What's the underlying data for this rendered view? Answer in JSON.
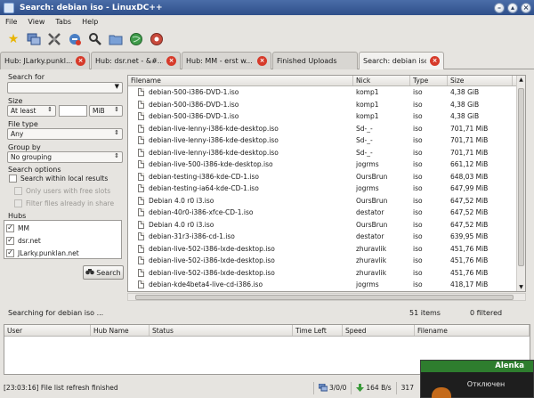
{
  "window": {
    "title": "Search: debian iso - LinuxDC++"
  },
  "menu": [
    "File",
    "View",
    "Tabs",
    "Help"
  ],
  "toolbar_icons": [
    "favorite-star-icon",
    "hubs-icon",
    "settings-icon",
    "connect-icon",
    "search-icon",
    "folder-icon",
    "globe-icon",
    "network-icon"
  ],
  "tabs": [
    {
      "label": "Hub: JLarky.punkl..."
    },
    {
      "label": "Hub: dsr.net - &#..."
    },
    {
      "label": "Hub: MM -  erst w..."
    },
    {
      "label": "Finished Uploads"
    },
    {
      "label": "Search: debian iso"
    }
  ],
  "search_panel": {
    "search_for_label": "Search for",
    "search_for_value": "",
    "size_label": "Size",
    "size_mode": "At least",
    "size_value": "",
    "size_unit": "MiB",
    "file_type_label": "File type",
    "file_type_value": "Any",
    "group_by_label": "Group by",
    "group_by_value": "No grouping",
    "options_label": "Search options",
    "opt_local": "Search within local results",
    "opt_free_slots": "Only users with free slots",
    "opt_filter_share": "Filter files already in share",
    "hubs_label": "Hubs",
    "hubs": [
      "MM",
      "dsr.net",
      "JLarky.punklan.net"
    ],
    "search_button": "Search"
  },
  "results": {
    "columns": [
      "Filename",
      "Nick",
      "Type",
      "Size"
    ],
    "rows": [
      [
        "debian-500-i386-DVD-1.iso",
        "komp1",
        "iso",
        "4,38 GiB"
      ],
      [
        "debian-500-i386-DVD-1.iso",
        "komp1",
        "iso",
        "4,38 GiB"
      ],
      [
        "debian-500-i386-DVD-1.iso",
        "komp1",
        "iso",
        "4,38 GiB"
      ],
      [
        "debian-live-lenny-i386-kde-desktop.iso",
        "Sd-_-",
        "iso",
        "701,71 MiB"
      ],
      [
        "debian-live-lenny-i386-kde-desktop.iso",
        "Sd-_-",
        "iso",
        "701,71 MiB"
      ],
      [
        "debian-live-lenny-i386-kde-desktop.iso",
        "Sd-_-",
        "iso",
        "701,71 MiB"
      ],
      [
        "debian-live-500-i386-kde-desktop.iso",
        "jogrms",
        "iso",
        "661,12 MiB"
      ],
      [
        "debian-testing-i386-kde-CD-1.iso",
        "OursBrun",
        "iso",
        "648,03 MiB"
      ],
      [
        "debian-testing-ia64-kde-CD-1.iso",
        "jogrms",
        "iso",
        "647,99 MiB"
      ],
      [
        "Debian 4.0 r0 i3.iso",
        "OursBrun",
        "iso",
        "647,52 MiB"
      ],
      [
        "debian-40r0-i386-xfce-CD-1.iso",
        "destator",
        "iso",
        "647,52 MiB"
      ],
      [
        "Debian 4.0 r0 i3.iso",
        "OursBrun",
        "iso",
        "647,52 MiB"
      ],
      [
        "debian-31r3-i386-cd-1.iso",
        "destator",
        "iso",
        "639,95 MiB"
      ],
      [
        "debian-live-502-i386-lxde-desktop.iso",
        "zhuravlik",
        "iso",
        "451,76 MiB"
      ],
      [
        "debian-live-502-i386-lxde-desktop.iso",
        "zhuravlik",
        "iso",
        "451,76 MiB"
      ],
      [
        "debian-live-502-i386-lxde-desktop.iso",
        "zhuravlik",
        "iso",
        "451,76 MiB"
      ],
      [
        "debian-kde4beta4-live-cd-i386.iso",
        "jogrms",
        "iso",
        "418,17 MiB"
      ]
    ]
  },
  "status": {
    "searching": "Searching for debian iso ...",
    "items": "51 items",
    "filtered": "0 filtered"
  },
  "transfers": {
    "columns": [
      "User",
      "Hub Name",
      "Status",
      "Time Left",
      "Speed",
      "Filename"
    ]
  },
  "statusbar": {
    "message": "[23:03:16] File list refresh finished",
    "hubs": "3/0/0",
    "download_speed": "164 B/s",
    "upload_partial": "317"
  },
  "notification": {
    "user": "Alenka",
    "text": "Отключен"
  }
}
